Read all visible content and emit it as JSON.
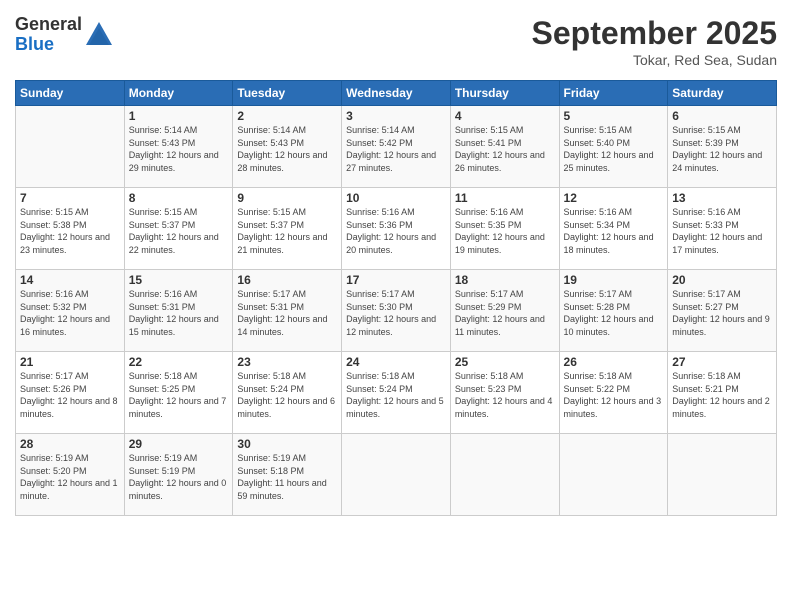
{
  "logo": {
    "general": "General",
    "blue": "Blue"
  },
  "title": "September 2025",
  "location": "Tokar, Red Sea, Sudan",
  "days_of_week": [
    "Sunday",
    "Monday",
    "Tuesday",
    "Wednesday",
    "Thursday",
    "Friday",
    "Saturday"
  ],
  "weeks": [
    [
      {
        "day": "",
        "info": ""
      },
      {
        "day": "1",
        "info": "Sunrise: 5:14 AM\nSunset: 5:43 PM\nDaylight: 12 hours\nand 29 minutes."
      },
      {
        "day": "2",
        "info": "Sunrise: 5:14 AM\nSunset: 5:43 PM\nDaylight: 12 hours\nand 28 minutes."
      },
      {
        "day": "3",
        "info": "Sunrise: 5:14 AM\nSunset: 5:42 PM\nDaylight: 12 hours\nand 27 minutes."
      },
      {
        "day": "4",
        "info": "Sunrise: 5:15 AM\nSunset: 5:41 PM\nDaylight: 12 hours\nand 26 minutes."
      },
      {
        "day": "5",
        "info": "Sunrise: 5:15 AM\nSunset: 5:40 PM\nDaylight: 12 hours\nand 25 minutes."
      },
      {
        "day": "6",
        "info": "Sunrise: 5:15 AM\nSunset: 5:39 PM\nDaylight: 12 hours\nand 24 minutes."
      }
    ],
    [
      {
        "day": "7",
        "info": "Sunrise: 5:15 AM\nSunset: 5:38 PM\nDaylight: 12 hours\nand 23 minutes."
      },
      {
        "day": "8",
        "info": "Sunrise: 5:15 AM\nSunset: 5:37 PM\nDaylight: 12 hours\nand 22 minutes."
      },
      {
        "day": "9",
        "info": "Sunrise: 5:15 AM\nSunset: 5:37 PM\nDaylight: 12 hours\nand 21 minutes."
      },
      {
        "day": "10",
        "info": "Sunrise: 5:16 AM\nSunset: 5:36 PM\nDaylight: 12 hours\nand 20 minutes."
      },
      {
        "day": "11",
        "info": "Sunrise: 5:16 AM\nSunset: 5:35 PM\nDaylight: 12 hours\nand 19 minutes."
      },
      {
        "day": "12",
        "info": "Sunrise: 5:16 AM\nSunset: 5:34 PM\nDaylight: 12 hours\nand 18 minutes."
      },
      {
        "day": "13",
        "info": "Sunrise: 5:16 AM\nSunset: 5:33 PM\nDaylight: 12 hours\nand 17 minutes."
      }
    ],
    [
      {
        "day": "14",
        "info": "Sunrise: 5:16 AM\nSunset: 5:32 PM\nDaylight: 12 hours\nand 16 minutes."
      },
      {
        "day": "15",
        "info": "Sunrise: 5:16 AM\nSunset: 5:31 PM\nDaylight: 12 hours\nand 15 minutes."
      },
      {
        "day": "16",
        "info": "Sunrise: 5:17 AM\nSunset: 5:31 PM\nDaylight: 12 hours\nand 14 minutes."
      },
      {
        "day": "17",
        "info": "Sunrise: 5:17 AM\nSunset: 5:30 PM\nDaylight: 12 hours\nand 12 minutes."
      },
      {
        "day": "18",
        "info": "Sunrise: 5:17 AM\nSunset: 5:29 PM\nDaylight: 12 hours\nand 11 minutes."
      },
      {
        "day": "19",
        "info": "Sunrise: 5:17 AM\nSunset: 5:28 PM\nDaylight: 12 hours\nand 10 minutes."
      },
      {
        "day": "20",
        "info": "Sunrise: 5:17 AM\nSunset: 5:27 PM\nDaylight: 12 hours\nand 9 minutes."
      }
    ],
    [
      {
        "day": "21",
        "info": "Sunrise: 5:17 AM\nSunset: 5:26 PM\nDaylight: 12 hours\nand 8 minutes."
      },
      {
        "day": "22",
        "info": "Sunrise: 5:18 AM\nSunset: 5:25 PM\nDaylight: 12 hours\nand 7 minutes."
      },
      {
        "day": "23",
        "info": "Sunrise: 5:18 AM\nSunset: 5:24 PM\nDaylight: 12 hours\nand 6 minutes."
      },
      {
        "day": "24",
        "info": "Sunrise: 5:18 AM\nSunset: 5:24 PM\nDaylight: 12 hours\nand 5 minutes."
      },
      {
        "day": "25",
        "info": "Sunrise: 5:18 AM\nSunset: 5:23 PM\nDaylight: 12 hours\nand 4 minutes."
      },
      {
        "day": "26",
        "info": "Sunrise: 5:18 AM\nSunset: 5:22 PM\nDaylight: 12 hours\nand 3 minutes."
      },
      {
        "day": "27",
        "info": "Sunrise: 5:18 AM\nSunset: 5:21 PM\nDaylight: 12 hours\nand 2 minutes."
      }
    ],
    [
      {
        "day": "28",
        "info": "Sunrise: 5:19 AM\nSunset: 5:20 PM\nDaylight: 12 hours\nand 1 minute."
      },
      {
        "day": "29",
        "info": "Sunrise: 5:19 AM\nSunset: 5:19 PM\nDaylight: 12 hours\nand 0 minutes."
      },
      {
        "day": "30",
        "info": "Sunrise: 5:19 AM\nSunset: 5:18 PM\nDaylight: 11 hours\nand 59 minutes."
      },
      {
        "day": "",
        "info": ""
      },
      {
        "day": "",
        "info": ""
      },
      {
        "day": "",
        "info": ""
      },
      {
        "day": "",
        "info": ""
      }
    ]
  ]
}
